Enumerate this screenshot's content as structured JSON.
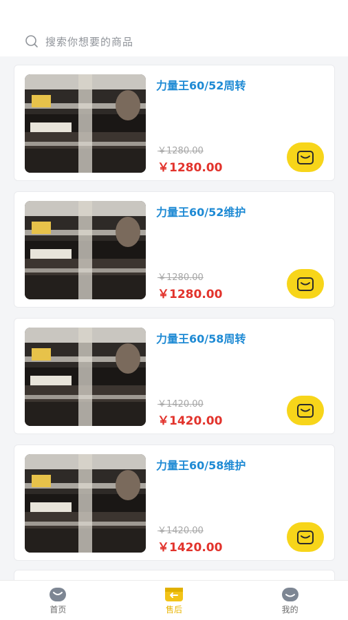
{
  "search": {
    "placeholder": "搜索你想要的商品"
  },
  "products": [
    {
      "title": "力量王60/52周转",
      "old_price": "￥1280.00",
      "price": "￥1280.00"
    },
    {
      "title": "力量王60/52维护",
      "old_price": "￥1280.00",
      "price": "￥1280.00"
    },
    {
      "title": "力量王60/58周转",
      "old_price": "￥1420.00",
      "price": "￥1420.00"
    },
    {
      "title": "力量王60/58维护",
      "old_price": "￥1420.00",
      "price": "￥1420.00"
    }
  ],
  "tabs": [
    {
      "label": "首页",
      "icon": "home-icon"
    },
    {
      "label": "售后",
      "icon": "after-sale-icon",
      "active": true
    },
    {
      "label": "我的",
      "icon": "profile-icon"
    }
  ],
  "colors": {
    "accent": "#f7d51a",
    "title": "#1e8ad4",
    "price": "#e2332c"
  }
}
